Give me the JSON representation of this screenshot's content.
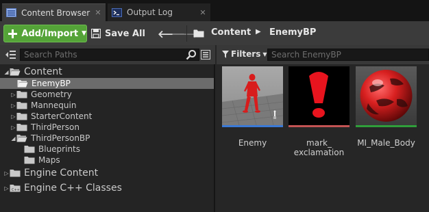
{
  "tabs": [
    {
      "label": "Content Browser",
      "icon": "content-browser-icon",
      "active": true
    },
    {
      "label": "Output Log",
      "icon": "output-log-icon",
      "active": false
    }
  ],
  "toolbar": {
    "add_import_label": "Add/Import",
    "save_all_label": "Save All",
    "breadcrumb": [
      "Content",
      "EnemyBP"
    ]
  },
  "left_panel": {
    "search_placeholder": "Search Paths",
    "tree": [
      {
        "label": "Content",
        "level": 0,
        "expanded": true
      },
      {
        "label": "EnemyBP",
        "level": 1,
        "selected": true
      },
      {
        "label": "Geometry",
        "level": 1
      },
      {
        "label": "Mannequin",
        "level": 1
      },
      {
        "label": "StarterContent",
        "level": 1
      },
      {
        "label": "ThirdPerson",
        "level": 1
      },
      {
        "label": "ThirdPersonBP",
        "level": 1,
        "expanded": true
      },
      {
        "label": "Blueprints",
        "level": 2
      },
      {
        "label": "Maps",
        "level": 2
      },
      {
        "label": "Engine Content",
        "level": 0
      },
      {
        "label": "Engine C++ Classes",
        "level": 0
      }
    ]
  },
  "right_panel": {
    "filters_label": "Filters",
    "search_placeholder": "Search EnemyBP",
    "assets": [
      {
        "name": "Enemy",
        "type_color": "#3a79d6"
      },
      {
        "name_line1": "mark_",
        "name_line2": "exclamation",
        "type_color": "#c45454"
      },
      {
        "name": "MI_Male_Body",
        "type_color": "#2f9e3a"
      }
    ]
  },
  "colors": {
    "accent_green": "#54a338",
    "selection": "#6c6c6c",
    "panel_bg": "#262626"
  }
}
